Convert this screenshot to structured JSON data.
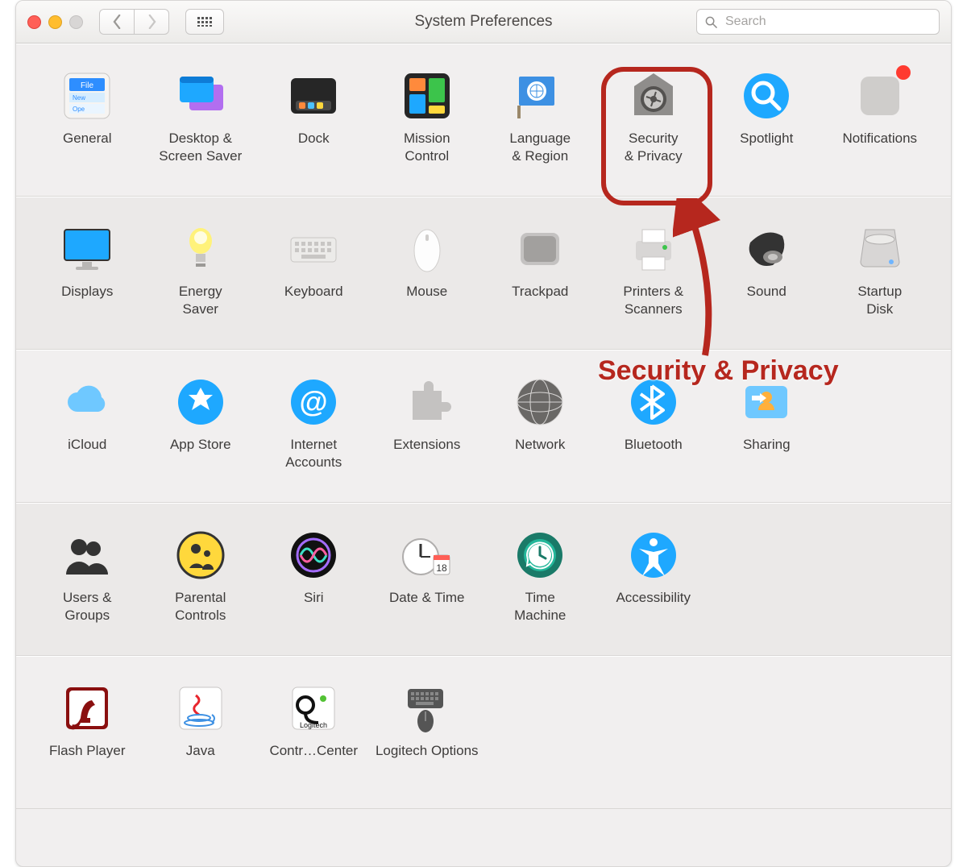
{
  "window": {
    "title": "System Preferences"
  },
  "toolbar": {
    "search_placeholder": "Search"
  },
  "annotation": {
    "callout": "Security & Privacy",
    "highlight_target": "security-privacy"
  },
  "rows": [
    {
      "alt": false,
      "items": [
        {
          "id": "general",
          "label": "General",
          "icon": "general-icon"
        },
        {
          "id": "desktop",
          "label": "Desktop &\nScreen Saver",
          "icon": "desktop-icon"
        },
        {
          "id": "dock",
          "label": "Dock",
          "icon": "dock-icon"
        },
        {
          "id": "mission-control",
          "label": "Mission\nControl",
          "icon": "mission-control-icon"
        },
        {
          "id": "language-region",
          "label": "Language\n& Region",
          "icon": "language-region-icon"
        },
        {
          "id": "security-privacy",
          "label": "Security\n& Privacy",
          "icon": "security-privacy-icon"
        },
        {
          "id": "spotlight",
          "label": "Spotlight",
          "icon": "spotlight-icon"
        },
        {
          "id": "notifications",
          "label": "Notifications",
          "icon": "notifications-icon",
          "badge": true
        }
      ]
    },
    {
      "alt": true,
      "items": [
        {
          "id": "displays",
          "label": "Displays",
          "icon": "displays-icon"
        },
        {
          "id": "energy-saver",
          "label": "Energy\nSaver",
          "icon": "energy-saver-icon"
        },
        {
          "id": "keyboard",
          "label": "Keyboard",
          "icon": "keyboard-icon"
        },
        {
          "id": "mouse",
          "label": "Mouse",
          "icon": "mouse-icon"
        },
        {
          "id": "trackpad",
          "label": "Trackpad",
          "icon": "trackpad-icon"
        },
        {
          "id": "printers",
          "label": "Printers &\nScanners",
          "icon": "printers-icon"
        },
        {
          "id": "sound",
          "label": "Sound",
          "icon": "sound-icon"
        },
        {
          "id": "startup-disk",
          "label": "Startup\nDisk",
          "icon": "startup-disk-icon"
        }
      ]
    },
    {
      "alt": false,
      "items": [
        {
          "id": "icloud",
          "label": "iCloud",
          "icon": "icloud-icon"
        },
        {
          "id": "app-store",
          "label": "App Store",
          "icon": "app-store-icon"
        },
        {
          "id": "internet-accounts",
          "label": "Internet\nAccounts",
          "icon": "internet-accounts-icon"
        },
        {
          "id": "extensions",
          "label": "Extensions",
          "icon": "extensions-icon"
        },
        {
          "id": "network",
          "label": "Network",
          "icon": "network-icon"
        },
        {
          "id": "bluetooth",
          "label": "Bluetooth",
          "icon": "bluetooth-icon"
        },
        {
          "id": "sharing",
          "label": "Sharing",
          "icon": "sharing-icon"
        }
      ]
    },
    {
      "alt": true,
      "items": [
        {
          "id": "users-groups",
          "label": "Users &\nGroups",
          "icon": "users-groups-icon"
        },
        {
          "id": "parental-controls",
          "label": "Parental\nControls",
          "icon": "parental-controls-icon"
        },
        {
          "id": "siri",
          "label": "Siri",
          "icon": "siri-icon"
        },
        {
          "id": "date-time",
          "label": "Date & Time",
          "icon": "date-time-icon"
        },
        {
          "id": "time-machine",
          "label": "Time\nMachine",
          "icon": "time-machine-icon"
        },
        {
          "id": "accessibility",
          "label": "Accessibility",
          "icon": "accessibility-icon"
        }
      ]
    },
    {
      "alt": false,
      "items": [
        {
          "id": "flash-player",
          "label": "Flash Player",
          "icon": "flash-player-icon"
        },
        {
          "id": "java",
          "label": "Java",
          "icon": "java-icon"
        },
        {
          "id": "logitech-control",
          "label": "Contr…Center",
          "icon": "logitech-control-icon"
        },
        {
          "id": "logitech-options",
          "label": "Logitech Options",
          "icon": "logitech-options-icon"
        }
      ]
    }
  ]
}
